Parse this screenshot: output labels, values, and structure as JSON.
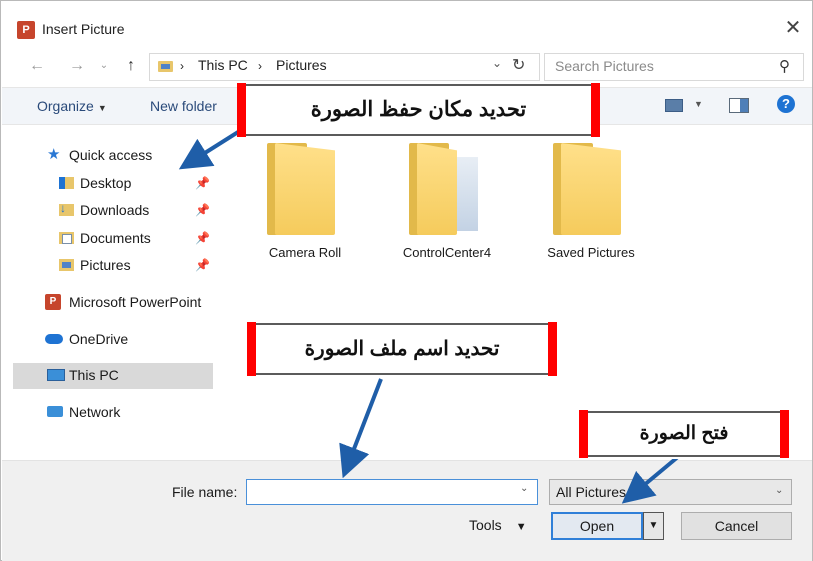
{
  "window": {
    "title": "Insert Picture",
    "app_icon": "P"
  },
  "address": {
    "root": "This PC",
    "current": "Pictures"
  },
  "search": {
    "placeholder": "Search Pictures"
  },
  "toolbar": {
    "organize": "Organize",
    "new_folder": "New folder"
  },
  "nav": {
    "quick_access": "Quick access",
    "items": [
      {
        "label": "Desktop"
      },
      {
        "label": "Downloads"
      },
      {
        "label": "Documents"
      },
      {
        "label": "Pictures"
      }
    ],
    "powerpoint": "Microsoft PowerPoint",
    "onedrive": "OneDrive",
    "thispc": "This PC",
    "network": "Network"
  },
  "files": [
    {
      "name": "Camera Roll"
    },
    {
      "name": "ControlCenter4"
    },
    {
      "name": "Saved Pictures"
    }
  ],
  "annotations": {
    "location": "تحديد مكان حفظ الصورة",
    "filename": "تحديد اسم ملف الصورة",
    "open": "فتح الصورة"
  },
  "bottom": {
    "file_name_label": "File name:",
    "file_name_value": "",
    "file_type": "All Pictures",
    "tools": "Tools",
    "open": "Open",
    "cancel": "Cancel"
  },
  "icons": {
    "back": "arrow-left-icon",
    "forward": "arrow-right-icon",
    "up": "arrow-up-icon",
    "refresh": "refresh-icon",
    "search": "search-icon",
    "help": "help-icon",
    "close": "close-icon",
    "pin": "pin-icon"
  },
  "colors": {
    "accent": "#1e73d3",
    "annotation_bar": "#ff0000",
    "arrow": "#1f5ea8",
    "folder": "#f5cb5c"
  }
}
